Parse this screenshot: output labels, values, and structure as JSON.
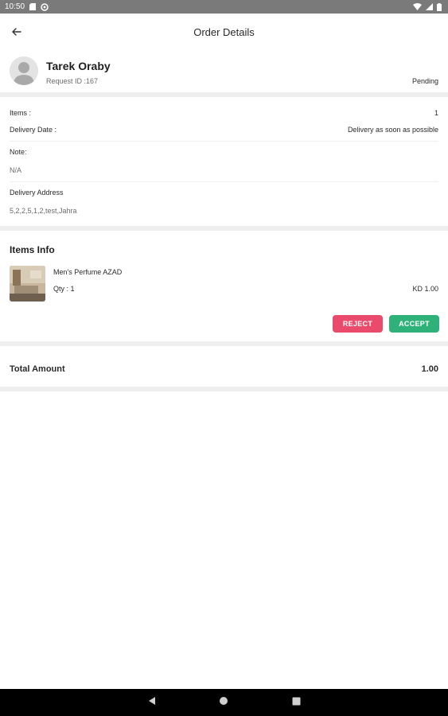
{
  "status_bar": {
    "time": "10:50",
    "icons": [
      "sd-card-icon",
      "sync-icon",
      "wifi-icon",
      "signal-icon",
      "battery-icon"
    ]
  },
  "app_bar": {
    "title": "Order Details",
    "back_icon": "back-arrow-icon"
  },
  "customer": {
    "name": "Tarek Oraby",
    "request_id": "Request ID :167",
    "status": "Pending",
    "avatar_icon": "user-avatar-icon"
  },
  "details": {
    "items_label": "Items :",
    "items_value": "1",
    "delivery_date_label": "Delivery Date :",
    "delivery_date_value": "Delivery as soon as possible",
    "note_label": "Note:",
    "note_value": "N/A",
    "address_label": "Delivery Address",
    "address_value": "5,2,2,5,1,2,test,Jahra"
  },
  "items_info": {
    "title": "Items Info",
    "items": [
      {
        "name": "Men's Perfume AZAD",
        "qty": "Qty : 1",
        "price": "KD 1.00"
      }
    ],
    "reject_label": "REJECT",
    "accept_label": "ACCEPT"
  },
  "total": {
    "label": "Total Amount",
    "value": "1.00"
  },
  "colors": {
    "reject": "#ea4a6b",
    "accept": "#2fb27a",
    "status_bar": "#7a7a7a",
    "separator": "#eeeeee"
  },
  "nav_bar": {
    "icons": [
      "back-triangle-icon",
      "home-circle-icon",
      "recents-square-icon"
    ]
  }
}
